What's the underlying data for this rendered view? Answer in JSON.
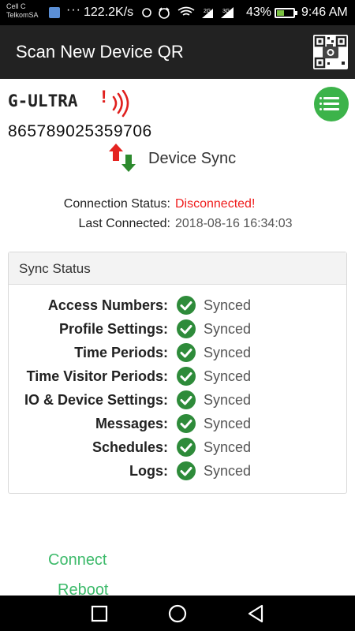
{
  "status_bar": {
    "carrier_line1": "Cell C",
    "carrier_line2": "TelkomSA",
    "notifications": "···",
    "speed": "122.2K/s",
    "icons_text": "✱ ⏰ ◠ ²ᴳ▌ ³ᴳ▌",
    "battery_percent": "43%",
    "battery_level": 0.43,
    "time": "9:46 AM"
  },
  "app_bar": {
    "title": "Scan New Device QR",
    "qr_icon": "qr-code-scan-icon"
  },
  "logo": {
    "text": "G-ULTRA",
    "mark": "!"
  },
  "device": {
    "id": "865789025359706",
    "sync_title": "Device Sync"
  },
  "connection": {
    "status_label": "Connection Status:",
    "status_value": "Disconnected!",
    "last_label": "Last Connected:",
    "last_value": "2018-08-16 16:34:03"
  },
  "sync_status": {
    "title": "Sync Status",
    "rows": [
      {
        "label": "Access Numbers:",
        "value": "Synced"
      },
      {
        "label": "Profile Settings:",
        "value": "Synced"
      },
      {
        "label": "Time Periods:",
        "value": "Synced"
      },
      {
        "label": "Time Visitor Periods:",
        "value": "Synced"
      },
      {
        "label": "IO & Device Settings:",
        "value": "Synced"
      },
      {
        "label": "Messages:",
        "value": "Synced"
      },
      {
        "label": "Schedules:",
        "value": "Synced"
      },
      {
        "label": "Logs:",
        "value": "Synced"
      }
    ]
  },
  "actions": {
    "connect": "Connect",
    "reboot": "Reboot"
  },
  "colors": {
    "accent_green": "#3cba6a",
    "check_green": "#2e8b3a",
    "error_red": "#ef1c1c",
    "app_bar": "#222222"
  }
}
